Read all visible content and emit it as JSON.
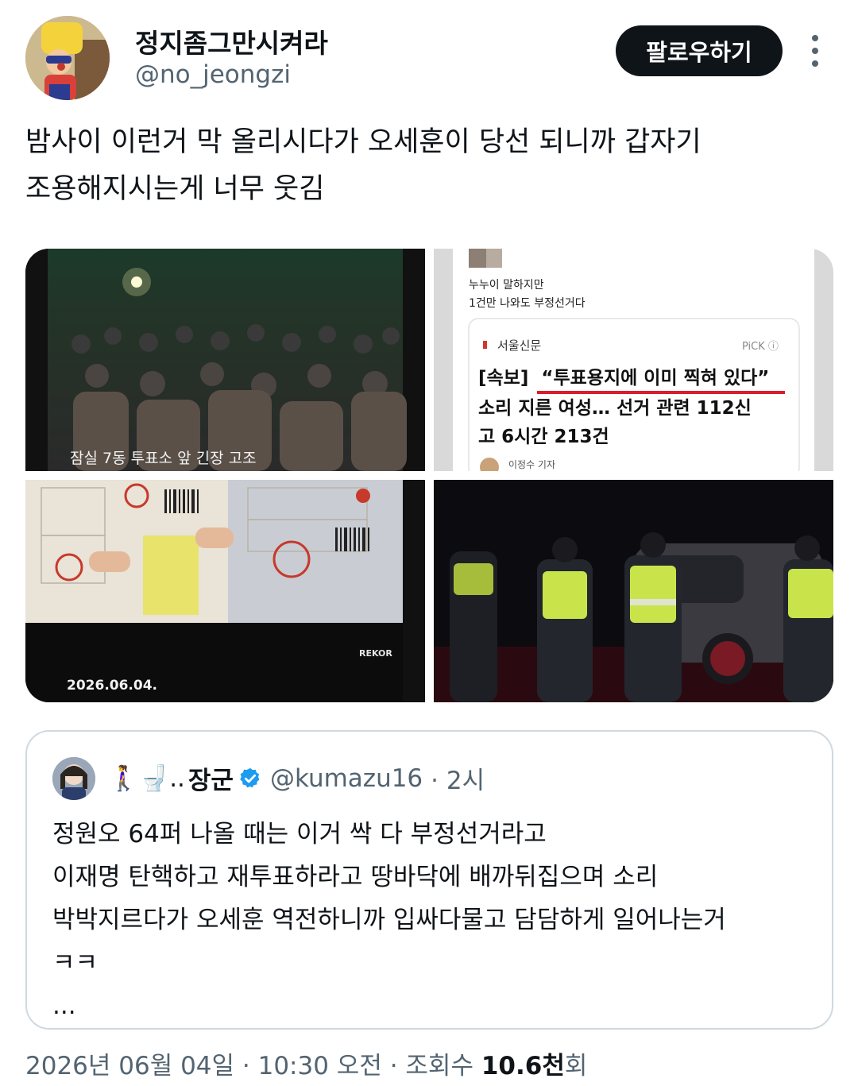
{
  "author": {
    "display_name": "정지좀그만시켜라",
    "handle": "@no_jeongzi",
    "follow_label": "팔로우하기"
  },
  "tweet": {
    "text_line1": "밤사이 이런거 막 올리시다가 오세훈이 당선 되니까 갑자기",
    "text_line2": "조용해지시는게 너무 웃김"
  },
  "media": {
    "image1_caption": "잠실 7동 투표소 앞 긴장 고조",
    "image2": {
      "post_line1": "누누이 말하지만",
      "post_line2": "1건만 나와도 부정선거다",
      "source": "서울신문",
      "pick": "PiCK ⓘ",
      "headline_tag": "[속보]",
      "headline_quote": "“투표용지에 이미 찍혀 있다”",
      "headline_line2": "소리 지른 여성… 선거 관련 112신",
      "headline_line3": "고 6시간 213건",
      "reporter": "이정수 기자"
    },
    "image3_date": "2026.06.04.",
    "image3_logo": "REKOR"
  },
  "quote": {
    "emoji": "🚶‍♀️🚽..",
    "name": "장군",
    "handle": "@kumazu16",
    "time": "· 2시",
    "line1": "정원오 64퍼 나올 때는 이거 싹 다 부정선거라고",
    "line2": "이재명 탄핵하고 재투표하라고 땅바닥에 배까뒤집으며 소리",
    "line3": "박박지르다가 오세훈 역전하니까 입싸다물고 담담하게 일어나는거",
    "line4": "ㅋㅋ",
    "line5": "..."
  },
  "meta": {
    "datetime": "2026년 06월 04일 · 10:30 오전 · 조회수 ",
    "views": "10.6천",
    "views_suffix": "회"
  },
  "colors": {
    "text_primary": "#0f1419",
    "text_secondary": "#536471",
    "border": "#cfd9de",
    "verified": "#1d9bf0",
    "headline_underline": "#d81e2c"
  },
  "icons": [
    "more-icon",
    "verified-badge-icon",
    "pick-info-icon"
  ]
}
